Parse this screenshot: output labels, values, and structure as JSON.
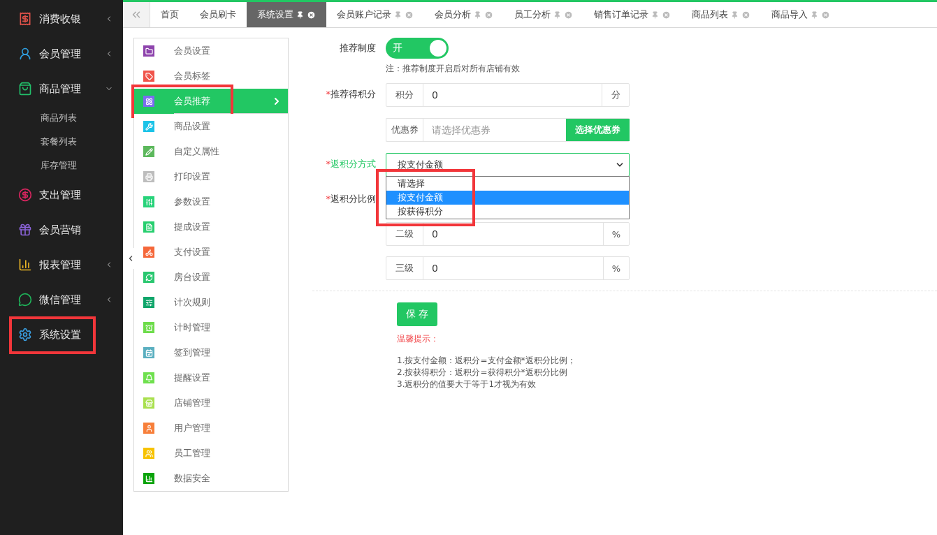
{
  "sidebar": {
    "items": [
      {
        "label": "消费收银",
        "color": "#e0524a",
        "expanded": false
      },
      {
        "label": "会员管理",
        "color": "#2f9fe0",
        "expanded": false
      },
      {
        "label": "商品管理",
        "color": "#22c06a",
        "expanded": true,
        "children": [
          {
            "label": "商品列表"
          },
          {
            "label": "套餐列表"
          },
          {
            "label": "库存管理"
          }
        ]
      },
      {
        "label": "支出管理",
        "color": "#d8265f"
      },
      {
        "label": "会员营销",
        "color": "#8a63d8"
      },
      {
        "label": "报表管理",
        "color": "#e8b326",
        "expanded": false
      },
      {
        "label": "微信管理",
        "color": "#1fb45a",
        "expanded": false
      },
      {
        "label": "系统设置",
        "color": "#3a9ee0",
        "highlighted": true
      }
    ]
  },
  "tabs": [
    {
      "label": "首页",
      "selected": false,
      "closable": false
    },
    {
      "label": "会员刷卡",
      "selected": false,
      "closable": false
    },
    {
      "label": "系统设置",
      "selected": true,
      "closable": true
    },
    {
      "label": "会员账户记录",
      "selected": false,
      "closable": true
    },
    {
      "label": "会员分析",
      "selected": false,
      "closable": true
    },
    {
      "label": "员工分析",
      "selected": false,
      "closable": true
    },
    {
      "label": "销售订单记录",
      "selected": false,
      "closable": true
    },
    {
      "label": "商品列表",
      "selected": false,
      "closable": true
    },
    {
      "label": "商品导入",
      "selected": false,
      "closable": true
    }
  ],
  "settings_menu": {
    "items": [
      {
        "label": "会员设置",
        "color": "#8e44ad",
        "selected": false,
        "highlighted": false
      },
      {
        "label": "会员标签",
        "color": "#f0544a",
        "selected": false,
        "highlighted": false
      },
      {
        "label": "会员推荐",
        "color": "#7b6cf0",
        "selected": true,
        "highlighted": true
      },
      {
        "label": "商品设置",
        "color": "#1bc3e8",
        "selected": false,
        "highlighted": false
      },
      {
        "label": "自定义属性",
        "color": "#5cb85c",
        "selected": false,
        "highlighted": false
      },
      {
        "label": "打印设置",
        "color": "#bdbdbd",
        "selected": false,
        "highlighted": false
      },
      {
        "label": "参数设置",
        "color": "#27d37a",
        "selected": false,
        "highlighted": false
      },
      {
        "label": "提成设置",
        "color": "#27cf6f",
        "selected": false,
        "highlighted": false
      },
      {
        "label": "支付设置",
        "color": "#f5673a",
        "selected": false,
        "highlighted": false
      },
      {
        "label": "房台设置",
        "color": "#28c76f",
        "selected": false,
        "highlighted": false
      },
      {
        "label": "计次规则",
        "color": "#0fa56a",
        "selected": false,
        "highlighted": false
      },
      {
        "label": "计时管理",
        "color": "#6ddc4a",
        "selected": false,
        "highlighted": false
      },
      {
        "label": "签到管理",
        "color": "#5aafc0",
        "selected": false,
        "highlighted": false
      },
      {
        "label": "提醒设置",
        "color": "#6fe04e",
        "selected": false,
        "highlighted": false
      },
      {
        "label": "店铺管理",
        "color": "#a9e04e",
        "selected": false,
        "highlighted": false
      },
      {
        "label": "用户管理",
        "color": "#f77f3a",
        "selected": false,
        "highlighted": false
      },
      {
        "label": "员工管理",
        "color": "#f7c200",
        "selected": false,
        "highlighted": false
      },
      {
        "label": "数据安全",
        "color": "#0aa30a",
        "selected": false,
        "highlighted": false
      }
    ]
  },
  "form": {
    "referral_system": {
      "label": "推荐制度",
      "on": true,
      "switch_text": "开",
      "note": "注：推荐制度开启后对所有店铺有效"
    },
    "referral_points": {
      "label": "推荐得积分",
      "required_mark": "*",
      "prefix": "积分",
      "value": "0",
      "suffix": "分"
    },
    "coupon": {
      "prefix": "优惠券",
      "placeholder": "请选择优惠券",
      "button": "选择优惠券"
    },
    "return_method": {
      "label": "返积分方式",
      "required_mark": "*",
      "focused": true,
      "value": "按支付金额",
      "expanded": true,
      "highlighted": true,
      "options": [
        {
          "label": "请选择",
          "selected": false
        },
        {
          "label": "按支付金额",
          "selected": true
        },
        {
          "label": "按获得积分",
          "selected": false
        }
      ]
    },
    "return_ratio": {
      "label": "返积分比例",
      "required_mark": "*",
      "levels": [
        {
          "prefix": "二级",
          "value": "0",
          "suffix": "%"
        },
        {
          "prefix": "三级",
          "value": "0",
          "suffix": "%"
        }
      ]
    },
    "save_button": "保 存",
    "tips": {
      "title": "温馨提示：",
      "lines": [
        "1.按支付金额：返积分=支付金额*返积分比例；",
        "2.按获得积分：返积分=获得积分*返积分比例",
        "3.返积分的值要大于等于1才视为有效"
      ]
    }
  }
}
